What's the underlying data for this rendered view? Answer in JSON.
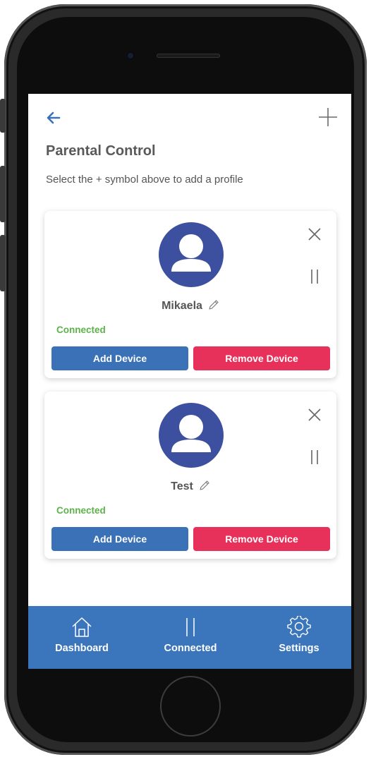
{
  "header": {
    "title": "Parental Control",
    "subtitle": "Select the + symbol above to add a profile",
    "back_icon": "arrow-left-icon",
    "add_icon": "plus-icon"
  },
  "profiles": [
    {
      "name": "Mikaela",
      "status": "Connected",
      "add_label": "Add Device",
      "remove_label": "Remove Device"
    },
    {
      "name": "Test",
      "status": "Connected",
      "add_label": "Add Device",
      "remove_label": "Remove Device"
    }
  ],
  "bottom_nav": [
    {
      "label": "Dashboard",
      "icon": "home-icon"
    },
    {
      "label": "Connected",
      "icon": "pause-icon"
    },
    {
      "label": "Settings",
      "icon": "gear-icon"
    }
  ],
  "colors": {
    "accent": "#3b71b7",
    "danger": "#e7305a",
    "success": "#5cb34a",
    "avatar": "#3d4f9f",
    "nav": "#3b75bb"
  }
}
